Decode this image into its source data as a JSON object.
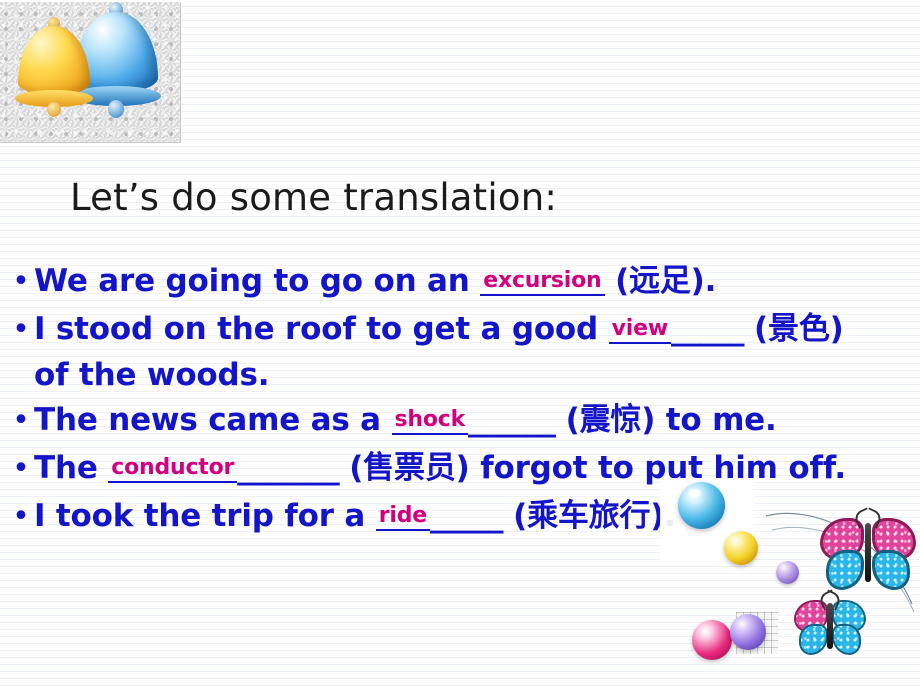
{
  "slide": {
    "title": "Let’s do some translation:",
    "bullet_marker": "•",
    "text_color": "#1414c8",
    "answer_color": "#d2007e",
    "items": [
      {
        "id": "item-1",
        "pre": "We are going to go on an ",
        "answer": "excursion",
        "blank": "",
        "post": " (远足).",
        "tail": ""
      },
      {
        "id": "item-2",
        "pre": "I stood on the roof to get a good ",
        "answer": "view",
        "blank": "_____",
        "post": " (景色)",
        "tail": "of the woods."
      },
      {
        "id": "item-3",
        "pre": "The news came as a ",
        "answer": "shock",
        "blank": "______",
        "post": " (震惊) to me.",
        "tail": ""
      },
      {
        "id": "item-4",
        "pre": "The ",
        "answer": "conductor",
        "blank": "_______",
        "post": " (售票员) forgot to put him off.",
        "tail": ""
      },
      {
        "id": "item-5",
        "pre": "I took the trip for a ",
        "answer": "ride",
        "blank": "_____",
        "post": " (乘车旅行).",
        "tail": ""
      }
    ]
  },
  "decorations": {
    "bells": {
      "name": "two-bells-clipart",
      "yellow_bell_color": "#ffd84d",
      "blue_bell_color": "#4aa8e8"
    },
    "marbles": [
      {
        "name": "blue-marble",
        "color": "#49b8e8"
      },
      {
        "name": "yellow-marble",
        "color": "#f5cf22"
      },
      {
        "name": "small-purple-marble",
        "color": "#a887e0"
      },
      {
        "name": "pink-marble",
        "color": "#e8297f"
      },
      {
        "name": "purple-marble",
        "color": "#8d6fe0"
      }
    ],
    "butterflies": [
      {
        "name": "large-butterfly",
        "upper_wing_color": "#e0459b",
        "lower_wing_color": "#29b6e8"
      },
      {
        "name": "small-butterfly",
        "upper_wing_color": "#29b6e8",
        "lower_wing_color": "#29b6e8"
      }
    ]
  }
}
